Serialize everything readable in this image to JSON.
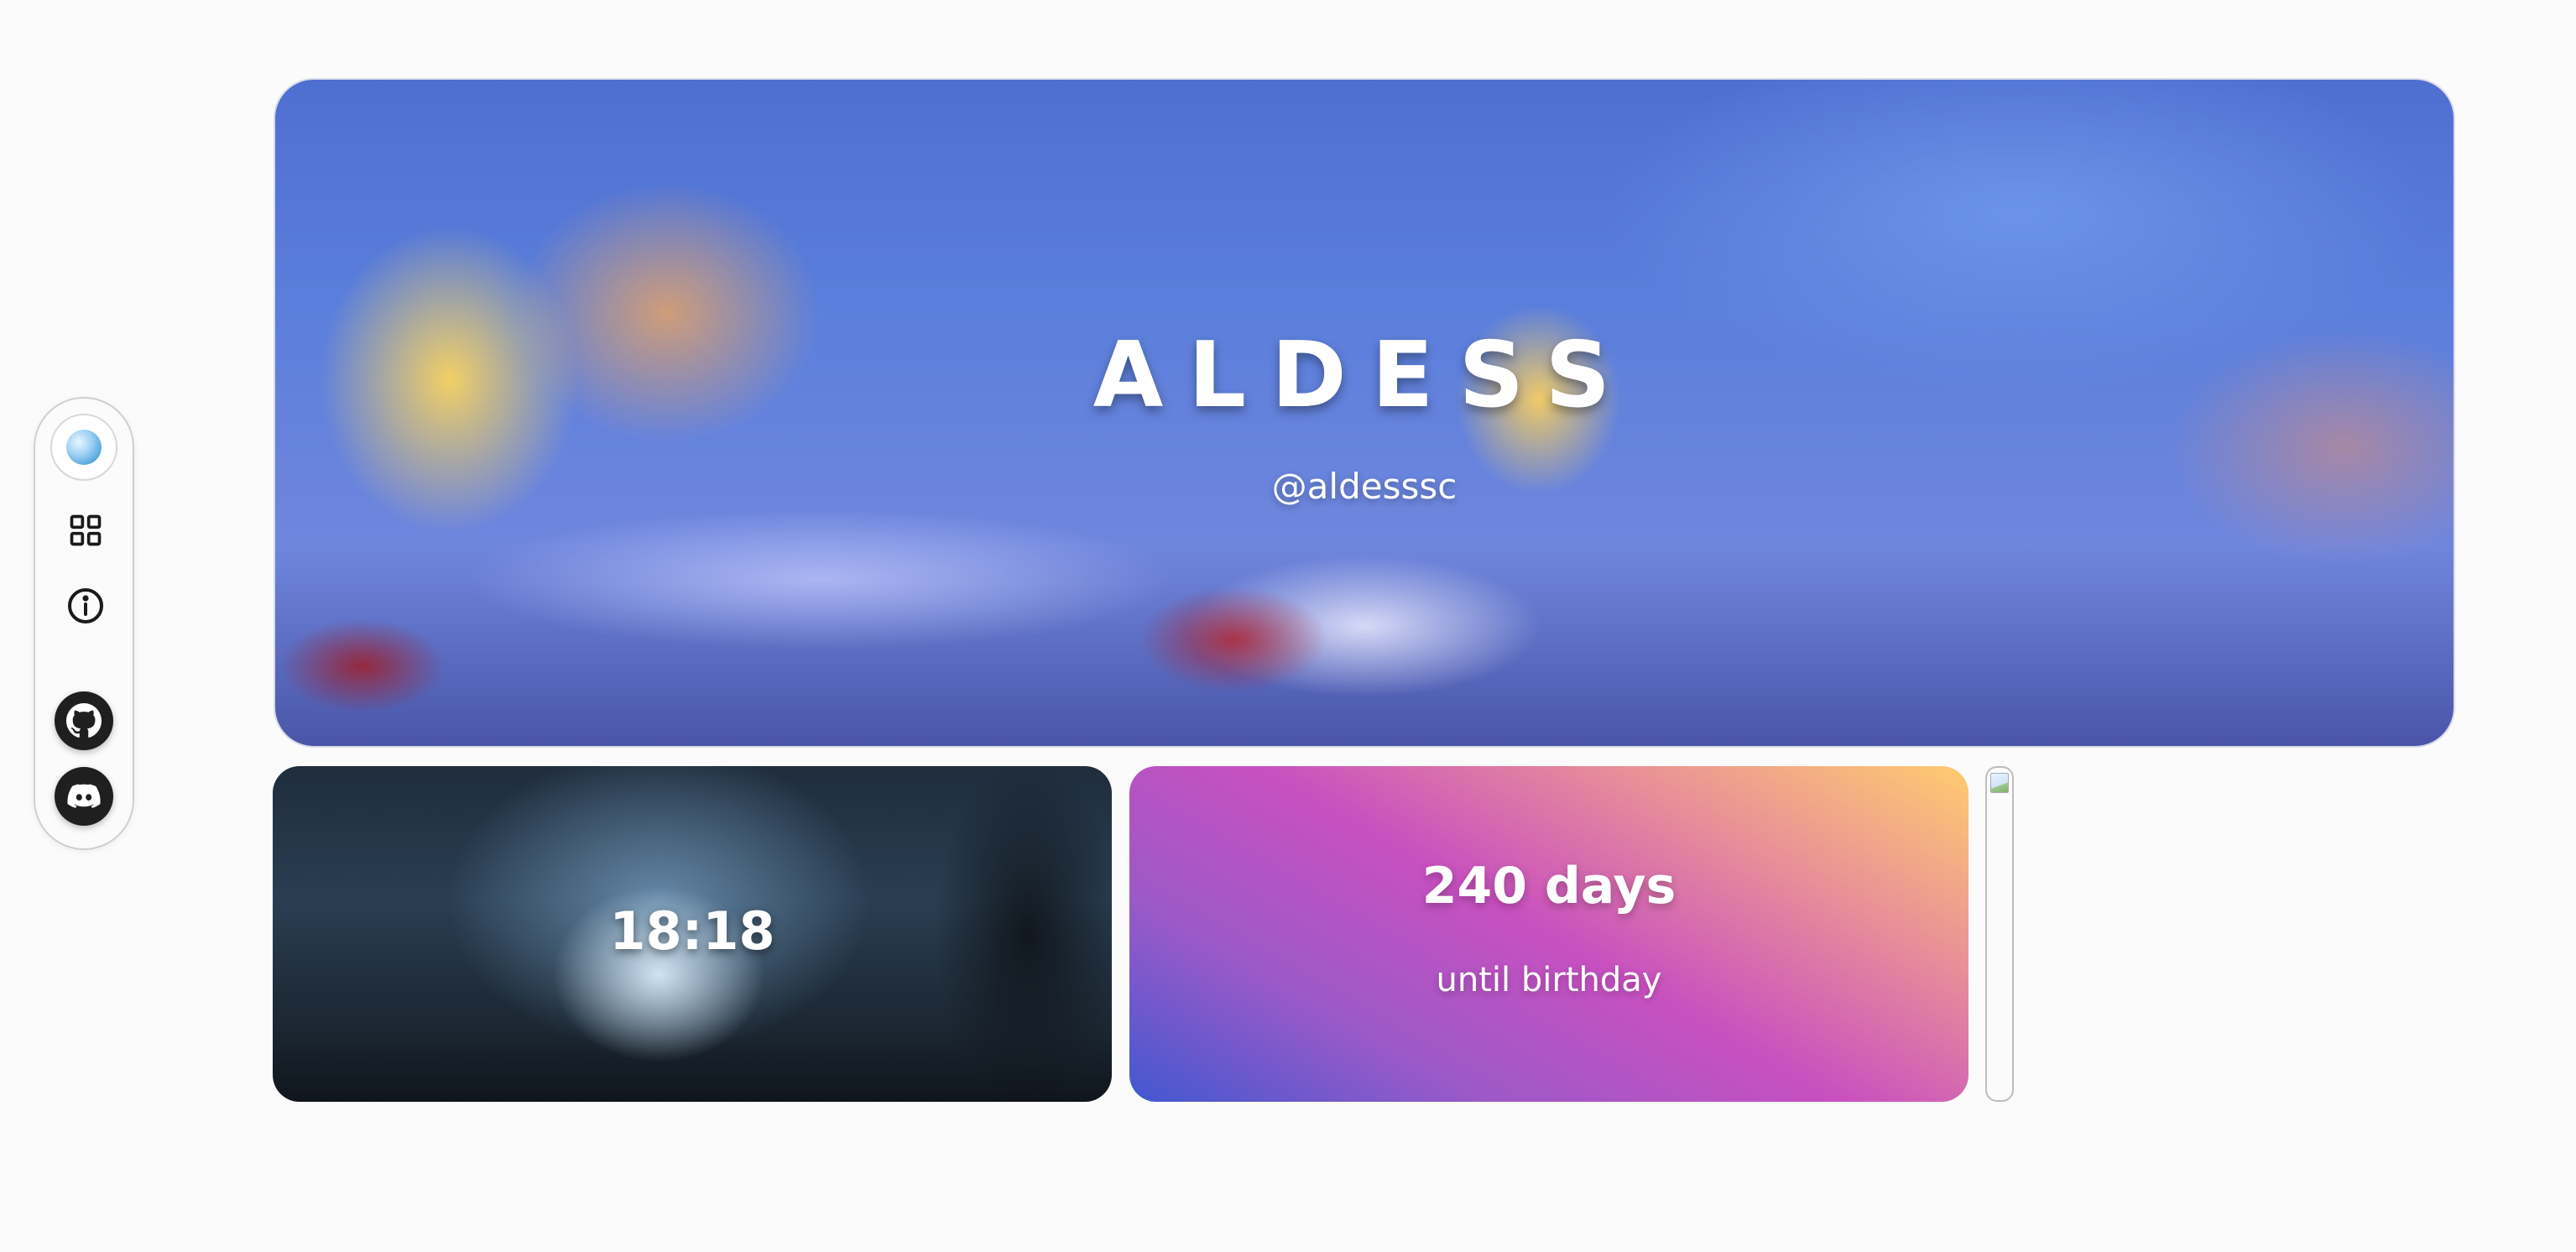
{
  "banner": {
    "title": "ALDESS",
    "handle": "@aldesssc"
  },
  "widgets": {
    "clock": {
      "time": "18:18"
    },
    "birthday": {
      "days": "240 days",
      "label": "until birthday"
    }
  },
  "sidebar": {
    "avatar_icon": "avatar-orb-icon",
    "items": [
      {
        "icon": "grid-icon"
      },
      {
        "icon": "info-icon"
      }
    ],
    "social": [
      {
        "icon": "github-icon"
      },
      {
        "icon": "discord-icon"
      }
    ]
  },
  "colors": {
    "page_background": "#fbfbfb",
    "social_button": "#1f1f1f",
    "birthday_gradient": [
      "#4158d0",
      "#c850c0",
      "#ffcc70"
    ]
  }
}
